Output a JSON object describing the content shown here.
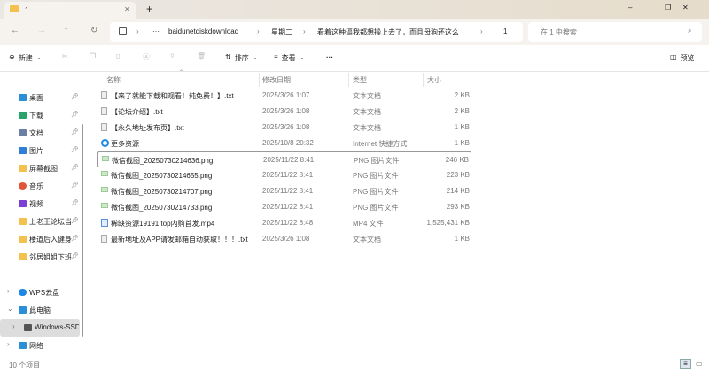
{
  "window": {
    "tab_title": "1",
    "new_tab": "+",
    "minimize": "–",
    "restore": "❐",
    "close": "✕",
    "tab_close": "✕"
  },
  "address": {
    "segments": [
      "baidunetdiskdownload",
      "星期二",
      "看着这种逼我都想操上去了，而且母狗还这么骚",
      "1"
    ],
    "ellipsis": "···",
    "search_placeholder": "在 1 中搜索"
  },
  "toolbar": {
    "new_label": "新建",
    "sort_label": "排序",
    "view_label": "查看",
    "more": "···",
    "preview_label": "预览"
  },
  "columns": {
    "name": "名称",
    "date": "修改日期",
    "type": "类型",
    "size": "大小"
  },
  "files": [
    {
      "name": "【来了就能下载和观看！纯免费！】.txt",
      "date": "2025/3/26 1:07",
      "type": "文本文档",
      "size": "2 KB",
      "icon": "text-file"
    },
    {
      "name": "【论坛介绍】.txt",
      "date": "2025/3/26 1:08",
      "type": "文本文档",
      "size": "2 KB",
      "icon": "text-file"
    },
    {
      "name": "【永久地址发布页】.txt",
      "date": "2025/3/26 1:08",
      "type": "文本文档",
      "size": "1 KB",
      "icon": "text-file"
    },
    {
      "name": "更多资源",
      "date": "2025/10/8 20:32",
      "type": "Internet 快捷方式",
      "size": "1 KB",
      "icon": "internet-shortcut"
    },
    {
      "name": "微信截图_20250730214636.png",
      "date": "2025/11/22 8:41",
      "type": "PNG 图片文件",
      "size": "246 KB",
      "icon": "image-file",
      "selected": true
    },
    {
      "name": "微信截图_20250730214655.png",
      "date": "2025/11/22 8:41",
      "type": "PNG 图片文件",
      "size": "223 KB",
      "icon": "image-file"
    },
    {
      "name": "微信截图_20250730214707.png",
      "date": "2025/11/22 8:41",
      "type": "PNG 图片文件",
      "size": "214 KB",
      "icon": "image-file"
    },
    {
      "name": "微信截图_20250730214733.png",
      "date": "2025/11/22 8:41",
      "type": "PNG 图片文件",
      "size": "293 KB",
      "icon": "image-file"
    },
    {
      "name": "稀缺资源19191.top内购首发.mp4",
      "date": "2025/11/22 8:48",
      "type": "MP4 文件",
      "size": "1,525,431 KB",
      "icon": "video-file"
    },
    {
      "name": "最新地址及APP请发邮箱自动获取！！！.txt",
      "date": "2025/3/26 1:08",
      "type": "文本文档",
      "size": "1 KB",
      "icon": "text-file"
    }
  ],
  "sidebar": {
    "quick": [
      {
        "label": "桌面",
        "icon": "desktop",
        "color": "#2a8fd6"
      },
      {
        "label": "下载",
        "icon": "download",
        "color": "#2aa36b"
      },
      {
        "label": "文档",
        "icon": "document",
        "color": "#6b7fa3"
      },
      {
        "label": "图片",
        "icon": "pictures",
        "color": "#2f7fd6"
      },
      {
        "label": "屏幕截图",
        "icon": "folder",
        "color": "#f2c14e"
      },
      {
        "label": "音乐",
        "icon": "music",
        "color": "#e0563b"
      },
      {
        "label": "视频",
        "icon": "video",
        "color": "#7b3fd6"
      },
      {
        "label": "上老王论坛当",
        "icon": "folder",
        "color": "#f2c14e"
      },
      {
        "label": "楼道后入健身",
        "icon": "folder",
        "color": "#f2c14e"
      },
      {
        "label": "邻居姐姐下班",
        "icon": "folder",
        "color": "#f2c14e"
      }
    ],
    "tree": [
      {
        "label": "WPS云盘",
        "chev": "›",
        "icon": "cloud",
        "color": "#1e88e5",
        "indent": 0
      },
      {
        "label": "此电脑",
        "chev": "⌄",
        "icon": "computer",
        "color": "#2a8fd6",
        "indent": 0
      },
      {
        "label": "Windows-SSD",
        "chev": "›",
        "icon": "drive",
        "color": "#555",
        "indent": 1,
        "selected": true
      },
      {
        "label": "网络",
        "chev": "›",
        "icon": "network",
        "color": "#2a8fd6",
        "indent": 0
      }
    ]
  },
  "status": {
    "count": "10 个项目"
  }
}
